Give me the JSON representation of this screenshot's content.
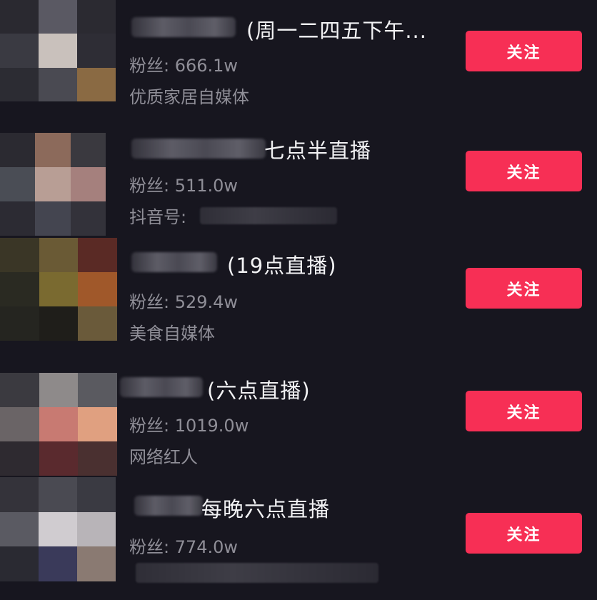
{
  "users": [
    {
      "title": "(周一二四五下午...",
      "fans_label": "粉丝: 666.1w",
      "desc": "优质家居自媒体",
      "follow_label": "关注",
      "avatar_colors": [
        "#2a2930",
        "#5a5963",
        "#2b2a31",
        "#3a3a42",
        "#c9c1bc",
        "#2e2d35",
        "#2c2c33",
        "#4a4a52",
        "#8a6a43"
      ]
    },
    {
      "title": "七点半直播",
      "fans_label": "粉丝: 511.0w",
      "desc": "抖音号:",
      "follow_label": "关注",
      "avatar_colors": [
        "#2b2a31",
        "#8c6a5b",
        "#3a393f",
        "#4a4d55",
        "#b89e95",
        "#a5807d",
        "#2c2b33",
        "#444550",
        "#33323a"
      ]
    },
    {
      "title": "(19点直播)",
      "fans_label": "粉丝: 529.4w",
      "desc": "美食自媒体",
      "follow_label": "关注",
      "avatar_colors": [
        "#3a3626",
        "#6a5a35",
        "#5a2a25",
        "#2a2a22",
        "#7a6a30",
        "#a0582a",
        "#252520",
        "#1f1e1a",
        "#6a5a3a"
      ]
    },
    {
      "title": "(六点直播)",
      "fans_label": "粉丝: 1019.0w",
      "desc": "网络红人",
      "follow_label": "关注",
      "avatar_colors": [
        "#3b3a40",
        "#8e8a8a",
        "#5a5a60",
        "#6a6466",
        "#c87a72",
        "#e0a080",
        "#2e2a30",
        "#5a2a2e",
        "#4a3030"
      ]
    },
    {
      "title": "每晚六点直播",
      "fans_label": "粉丝: 774.0w",
      "desc": "",
      "follow_label": "关注",
      "avatar_colors": [
        "#34333a",
        "#4a4a52",
        "#3a3a42",
        "#5a5a62",
        "#d0ccd0",
        "#b8b4b8",
        "#2a2a32",
        "#3a3a5a",
        "#8a7a72"
      ]
    }
  ]
}
